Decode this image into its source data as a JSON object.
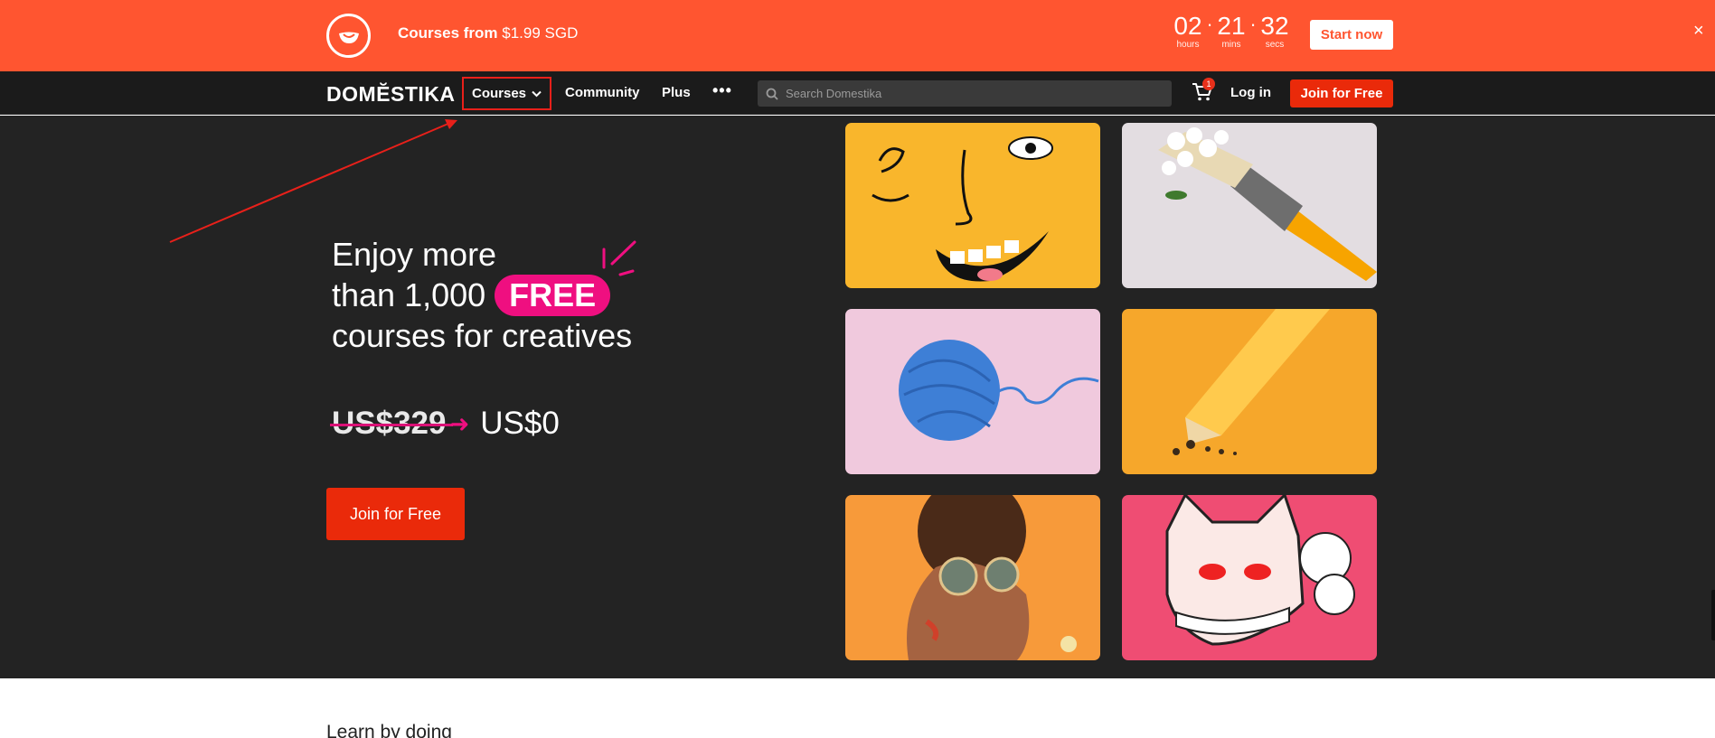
{
  "promo": {
    "logo_icon": "domestika-bowl-icon",
    "text_bold": "Courses from",
    "text_price": "$1.99 SGD",
    "countdown": [
      {
        "value": "02",
        "label": "hours"
      },
      {
        "value": "21",
        "label": "mins"
      },
      {
        "value": "32",
        "label": "secs"
      }
    ],
    "start_label": "Start now",
    "close_label": "×"
  },
  "nav": {
    "logo": "DOMĔSTIKA",
    "courses_label": "Courses",
    "community_label": "Community",
    "plus_label": "Plus",
    "more_label": "•••",
    "search_placeholder": "Search Domestika",
    "cart_count": "1",
    "login_label": "Log in",
    "join_label": "Join for Free"
  },
  "hero": {
    "line1": "Enjoy more",
    "line2_prefix": "than 1,000",
    "line2_pill": "FREE",
    "line3": "courses for creatives",
    "old_price": "US$329",
    "new_price": "US$0",
    "join_label": "Join for Free",
    "tiles": [
      "face-illustration",
      "paintbrush-flowers",
      "yarn-ball",
      "pencil",
      "woman-sunglasses",
      "fox-mask"
    ]
  },
  "section": {
    "title": "Learn by doing"
  },
  "colors": {
    "promo_bg": "#ff5530",
    "nav_bg": "#1b1b1b",
    "hero_bg": "#232323",
    "accent": "#ea2a0a",
    "pink": "#ef0f80",
    "highlight": "#e8201a"
  }
}
